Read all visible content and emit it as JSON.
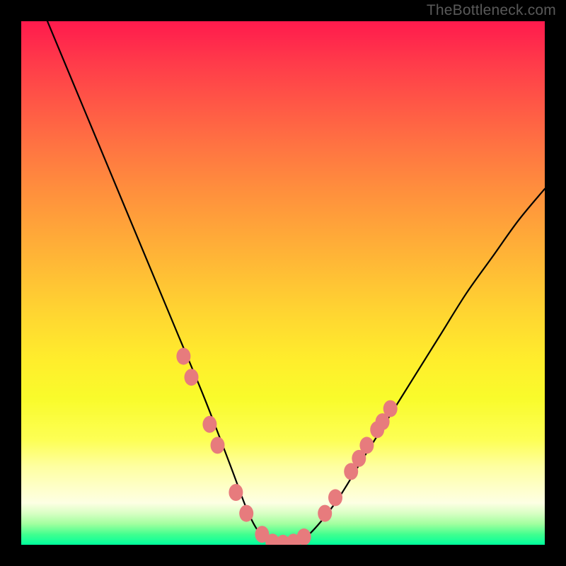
{
  "watermark": "TheBottleneck.com",
  "colors": {
    "background": "#000000",
    "curve": "#000000",
    "marker": "#e77b7d",
    "gradient_top": "#ff1a4d",
    "gradient_bottom": "#00ff9c"
  },
  "chart_data": {
    "type": "line",
    "title": "",
    "xlabel": "",
    "ylabel": "",
    "xlim": [
      0,
      100
    ],
    "ylim": [
      0,
      100
    ],
    "series": [
      {
        "name": "bottleneck-curve",
        "x": [
          5,
          10,
          15,
          20,
          25,
          30,
          35,
          40,
          43,
          45,
          47,
          50,
          52,
          55,
          60,
          65,
          70,
          75,
          80,
          85,
          90,
          95,
          100
        ],
        "values": [
          100,
          88,
          76,
          64,
          52,
          40,
          28,
          15,
          7,
          3,
          1,
          0,
          0.5,
          2,
          8,
          16,
          24,
          32,
          40,
          48,
          55,
          62,
          68
        ]
      }
    ],
    "markers": {
      "name": "highlighted-points",
      "points": [
        {
          "x": 31,
          "y": 36
        },
        {
          "x": 32.5,
          "y": 32
        },
        {
          "x": 36,
          "y": 23
        },
        {
          "x": 37.5,
          "y": 19
        },
        {
          "x": 41,
          "y": 10
        },
        {
          "x": 43,
          "y": 6
        },
        {
          "x": 46,
          "y": 2
        },
        {
          "x": 48,
          "y": 0.5
        },
        {
          "x": 50,
          "y": 0.3
        },
        {
          "x": 52,
          "y": 0.5
        },
        {
          "x": 54,
          "y": 1.5
        },
        {
          "x": 58,
          "y": 6
        },
        {
          "x": 60,
          "y": 9
        },
        {
          "x": 63,
          "y": 14
        },
        {
          "x": 64.5,
          "y": 16.5
        },
        {
          "x": 66,
          "y": 19
        },
        {
          "x": 68,
          "y": 22
        },
        {
          "x": 69,
          "y": 23.5
        },
        {
          "x": 70.5,
          "y": 26
        }
      ]
    }
  }
}
